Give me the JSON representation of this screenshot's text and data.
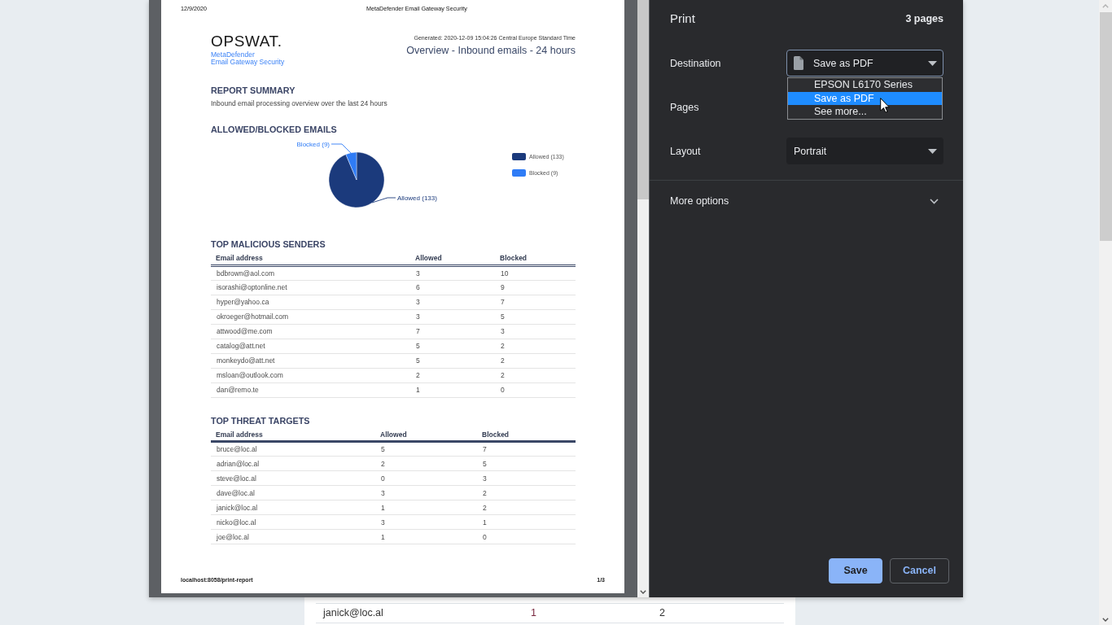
{
  "background_page": {
    "rows": [
      [
        "janick@loc.al",
        "1",
        "2"
      ]
    ]
  },
  "preview": {
    "page_header": {
      "date": "12/9/2020",
      "title": "MetaDefender Email Gateway Security"
    },
    "logo": {
      "wordmark": "OPSWAT.",
      "lines": [
        "MetaDefender",
        "Email Gateway Security"
      ]
    },
    "generated": "Generated: 2020-12-09 15:04:26 Central Europe Standard Time",
    "report_title": "Overview - Inbound emails - 24 hours",
    "sections": [
      {
        "kind": "text",
        "heading": "REPORT SUMMARY",
        "text": "Inbound email processing overview over the last 24 hours"
      },
      {
        "kind": "chart",
        "heading": "ALLOWED/BLOCKED EMAILS",
        "chart_data": {
          "type": "pie",
          "categories": [
            "Allowed (133)",
            "Blocked (9)"
          ],
          "values": [
            133,
            9
          ],
          "colors": [
            "#1b3a7c",
            "#2f7cf6"
          ],
          "value_labels": [
            "Allowed (133)",
            "Blocked (9)"
          ],
          "legend": "right"
        }
      },
      {
        "kind": "table",
        "heading": "TOP MALICIOUS SENDERS",
        "double_header_rule": true,
        "columns": [
          "Email address",
          "Allowed",
          "Blocked"
        ],
        "rows": [
          [
            "bdbrown@aol.com",
            "3",
            "10"
          ],
          [
            "isorashi@optonline.net",
            "6",
            "9"
          ],
          [
            "hyper@yahoo.ca",
            "3",
            "7"
          ],
          [
            "okroeger@hotmail.com",
            "3",
            "5"
          ],
          [
            "attwood@me.com",
            "7",
            "3"
          ],
          [
            "catalog@att.net",
            "5",
            "2"
          ],
          [
            "monkeydo@att.net",
            "5",
            "2"
          ],
          [
            "msloan@outlook.com",
            "2",
            "2"
          ],
          [
            "dan@remo.te",
            "1",
            "0"
          ]
        ]
      },
      {
        "kind": "table",
        "heading": "TOP THREAT TARGETS",
        "double_header_rule": false,
        "columns": [
          "Email address",
          "Allowed",
          "Blocked"
        ],
        "rows": [
          [
            "bruce@loc.al",
            "5",
            "7"
          ],
          [
            "adrian@loc.al",
            "2",
            "5"
          ],
          [
            "steve@loc.al",
            "0",
            "3"
          ],
          [
            "dave@loc.al",
            "3",
            "2"
          ],
          [
            "janick@loc.al",
            "1",
            "2"
          ],
          [
            "nicko@loc.al",
            "3",
            "1"
          ],
          [
            "joe@loc.al",
            "1",
            "0"
          ]
        ]
      }
    ],
    "page_footer": {
      "url": "localhost:8058/print-report",
      "page_number": "1/3"
    }
  },
  "print_panel": {
    "title": "Print",
    "page_count": "3 pages",
    "settings": [
      {
        "label": "Destination",
        "kind": "destination",
        "value": "Save as PDF",
        "expanded": true,
        "options": [
          {
            "label": "EPSON L6170 Series",
            "selected": false
          },
          {
            "label": "Save as PDF",
            "selected": true
          },
          {
            "label": "See more...",
            "selected": false
          }
        ]
      },
      {
        "label": "Pages",
        "kind": "label"
      },
      {
        "label": "Layout",
        "kind": "select",
        "value": "Portrait",
        "expanded": false
      }
    ],
    "more_options": {
      "label": "More options",
      "expanded": false
    },
    "buttons": [
      {
        "label": "Save",
        "kind": "primary"
      },
      {
        "label": "Cancel",
        "kind": "secondary"
      }
    ]
  }
}
